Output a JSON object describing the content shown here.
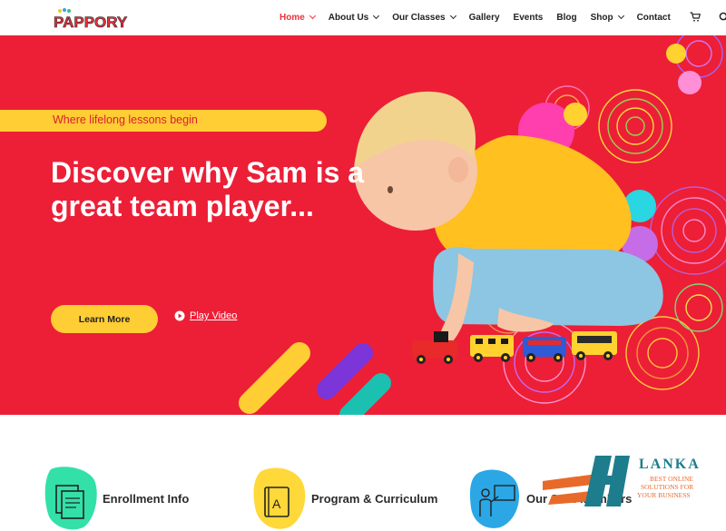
{
  "header": {
    "logo_text": "PAPPORY",
    "nav": [
      {
        "label": "Home",
        "active": true,
        "dropdown": true
      },
      {
        "label": "About Us",
        "dropdown": true
      },
      {
        "label": "Our Classes",
        "dropdown": true
      },
      {
        "label": "Gallery",
        "dropdown": false
      },
      {
        "label": "Events",
        "dropdown": false
      },
      {
        "label": "Blog",
        "dropdown": false
      },
      {
        "label": "Shop",
        "dropdown": true
      },
      {
        "label": "Contact",
        "dropdown": false
      }
    ],
    "icons": [
      "cart-icon",
      "search-icon"
    ]
  },
  "hero": {
    "tagline": "Where lifelong lessons begin",
    "headline": "Discover why Sam is a great team player...",
    "learn_more": "Learn More",
    "play_video": "Play Video",
    "colors": {
      "background": "#ec1f37",
      "accent": "#ffcd34",
      "text": "#ffffff"
    }
  },
  "features": [
    {
      "title": "Enrollment Info",
      "icon": "document-icon",
      "blob_color": "#33e0a8"
    },
    {
      "title": "Program & Curriculum",
      "icon": "book-icon",
      "blob_color": "#ffd83a"
    },
    {
      "title": "Our Staff Members",
      "icon": "teacher-icon",
      "blob_color": "#2ba7e6"
    }
  ],
  "watermark": {
    "brand": "LANKA",
    "tagline_lines": [
      "BEST ONLINE",
      "SOLUTIONS FOR",
      "YOUR BUSINESS"
    ]
  }
}
